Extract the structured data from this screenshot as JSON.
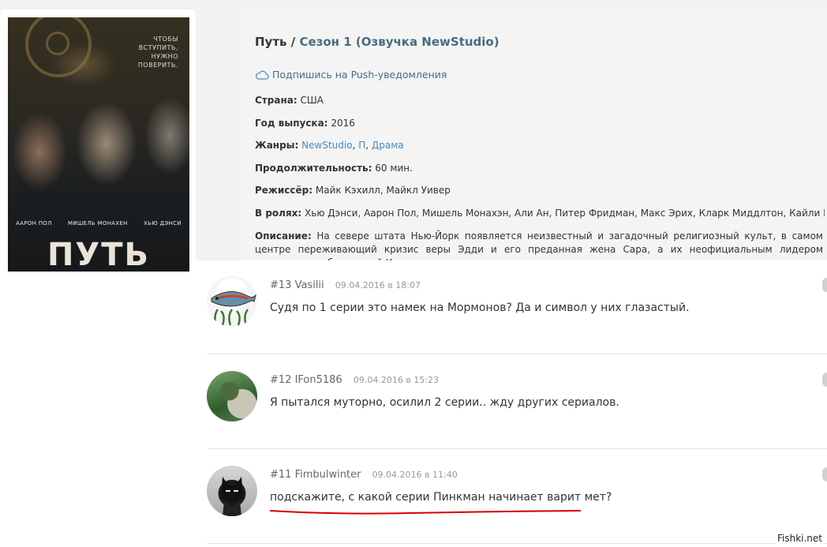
{
  "poster": {
    "tagline": "ЧТОБЫ ВСТУПИТЬ, НУЖНО ПОВЕРИТЬ.",
    "actors": [
      "ААРОН ПОЛ",
      "МИШЕЛЬ МОНАХЕН",
      "ХЬЮ ДЭНСИ"
    ],
    "title": "ПУТЬ"
  },
  "info": {
    "title_main": "Путь / ",
    "title_season": "Сезон 1 (Озвучка NewStudio)",
    "push_label": "Подпишись на Push-уведомления",
    "country_label": "Страна:",
    "country": "США",
    "year_label": "Год выпуска:",
    "year": "2016",
    "genres_label": "Жанры:",
    "genres": [
      "NewStudio",
      "П",
      "Драма"
    ],
    "duration_label": "Продолжительность:",
    "duration": "60 мин.",
    "director_label": "Режиссёр:",
    "director": "Майк Кэхилл, Майкл Уивер",
    "cast_label": "В ролях:",
    "cast": "Хью Дэнси, Аарон Пол, Мишель Монахэн, Али Ан, Питер Фридман, Макс Эрих, Кларк Миддлтон, Кайли Вернофф, Уитн",
    "desc_label": "Описание:",
    "desc": "На севере штата Нью-Йорк появляется неизвестный и загадочный религиозный культ, в самом центре переживающий кризис веры Эдди и его преданная жена Сара, а их неофициальным лидером становится амбициозный Кэл."
  },
  "comments": [
    {
      "num": "#13",
      "author": "Vasilii",
      "date": "09.04.2016 в 18:07",
      "text": "Судя по 1 серии это намек на Мормонов? Да и символ у них глазастый.",
      "avatar": "fish-avatar"
    },
    {
      "num": "#12",
      "author": "IFon5186",
      "date": "09.04.2016 в 15:23",
      "text": "Я пытался муторно, осилил 2 серии.. жду других сериалов.",
      "avatar": "photo-avatar"
    },
    {
      "num": "#11",
      "author": "Fimbulwinter",
      "date": "09.04.2016 в 11:40",
      "text": "подскажите, с какой серии Пинкман начинает варит мет?",
      "avatar": "batman-avatar"
    }
  ],
  "watermark": "Fishki.net",
  "colors": {
    "link": "#4a8ac0",
    "title_accent": "#4a6a7f",
    "underline": "#d40000"
  }
}
